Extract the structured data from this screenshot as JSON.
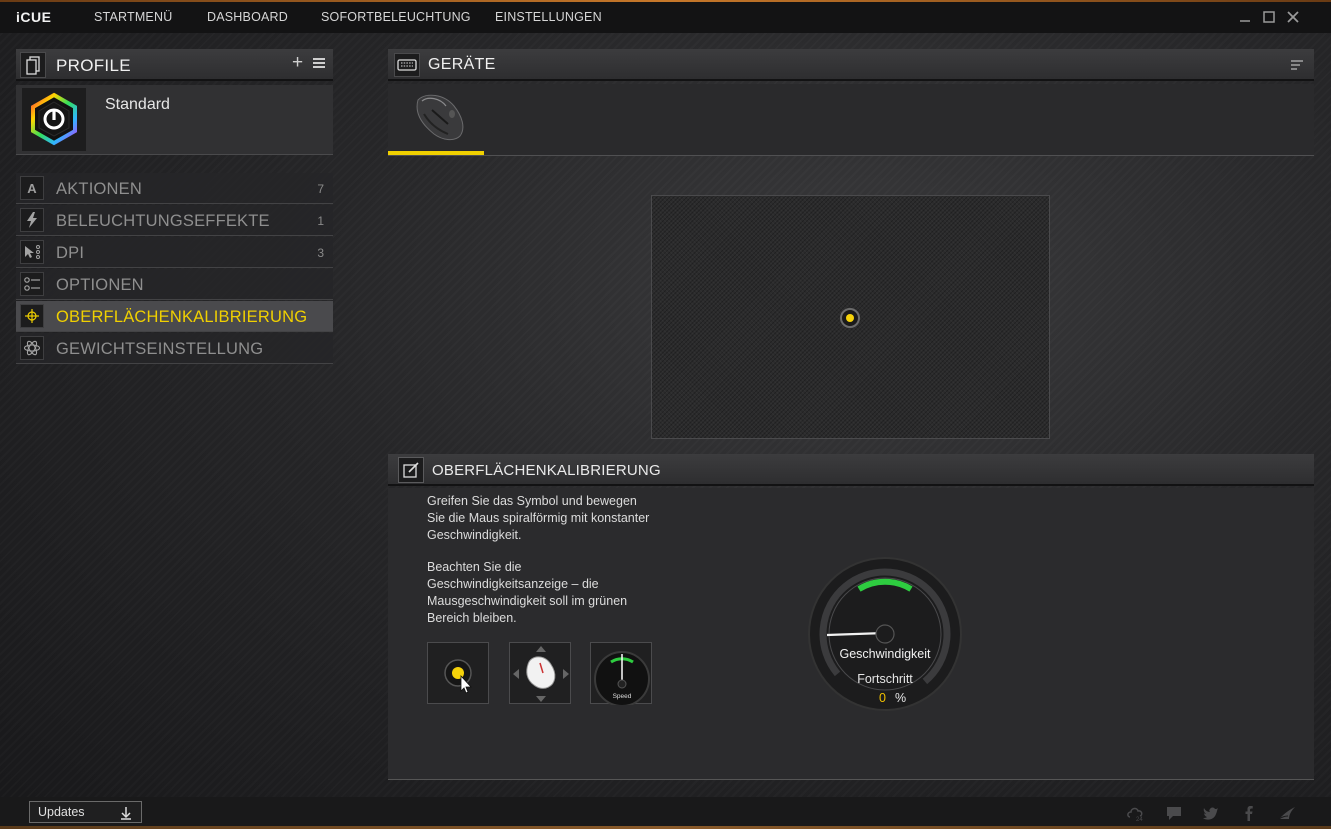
{
  "app": {
    "name": "iCUE"
  },
  "nav": {
    "items": [
      {
        "label": "STARTMENÜ"
      },
      {
        "label": "DASHBOARD"
      },
      {
        "label": "SOFORTBELEUCHTUNG"
      },
      {
        "label": "EINSTELLUNGEN"
      }
    ]
  },
  "window_controls": [
    "minimize-icon",
    "maximize-icon",
    "close-icon"
  ],
  "profiles": {
    "title": "PROFILE",
    "add_icon": "plus-icon",
    "menu_icon": "hamburger-icon",
    "current": {
      "name": "Standard",
      "icon": "icue-logo-icon"
    }
  },
  "menu": {
    "items": [
      {
        "label": "AKTIONEN",
        "count": "7",
        "icon": "letter-a-icon",
        "active": false
      },
      {
        "label": "BELEUCHTUNGSEFFEKTE",
        "count": "1",
        "icon": "lightning-icon",
        "active": false
      },
      {
        "label": "DPI",
        "count": "3",
        "icon": "cursor-dpi-icon",
        "active": false
      },
      {
        "label": "OPTIONEN",
        "count": "",
        "icon": "options-list-icon",
        "active": false
      },
      {
        "label": "OBERFLÄCHENKALIBRIERUNG",
        "count": "",
        "icon": "crosshair-icon",
        "active": true
      },
      {
        "label": "GEWICHTSEINSTELLUNG",
        "count": "",
        "icon": "weight-icon",
        "active": false
      }
    ]
  },
  "devices": {
    "title": "GERÄTE",
    "selected_device_icon": "gaming-mouse-icon"
  },
  "calibration": {
    "title": "OBERFLÄCHENKALIBRIERUNG",
    "instruction_1": "Greifen Sie das Symbol und bewegen Sie die Maus spiralförmig mit konstanter Geschwindigkeit.",
    "instruction_2": "Beachten Sie die Geschwindigkeitsanzeige – die Mausgeschwindigkeit soll im grünen Bereich bleiben.",
    "speed_label": "Geschwindigkeit",
    "progress_label": "Fortschritt",
    "progress_value": "0",
    "progress_unit": "%",
    "thumb_speed_label": "Speed",
    "speed_fraction": 0.0
  },
  "colors": {
    "accent": "#f0d000",
    "progress_value": "#f0c000",
    "gauge_green": "#2ecc40"
  },
  "footer": {
    "updates_label": "Updates",
    "icons": [
      "cloud-24-icon",
      "chat-icon",
      "twitter-icon",
      "facebook-icon",
      "corsair-sails-icon"
    ]
  }
}
